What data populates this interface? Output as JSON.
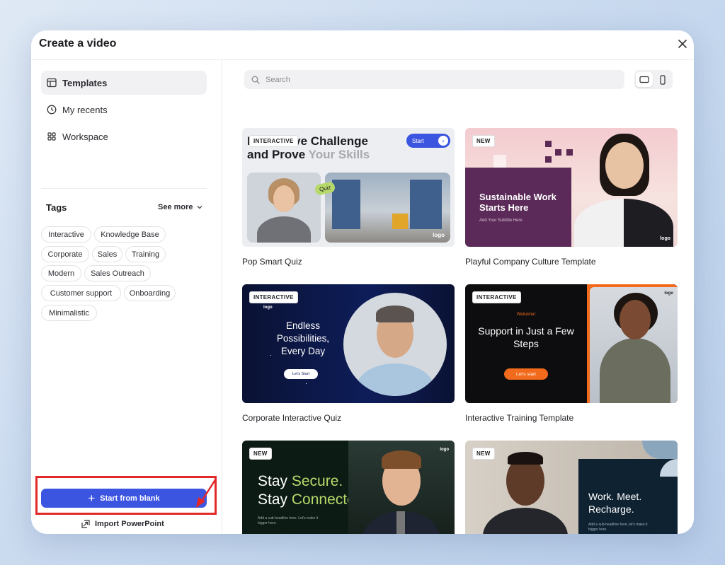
{
  "modal": {
    "title": "Create a video"
  },
  "sidebar": {
    "nav": [
      {
        "label": "Templates",
        "icon": "templates-icon",
        "active": true
      },
      {
        "label": "My recents",
        "icon": "clock-icon"
      },
      {
        "label": "Workspace",
        "icon": "grid-icon"
      }
    ],
    "tags_title": "Tags",
    "see_more": "See more",
    "tags": [
      "Interactive",
      "Knowledge Base",
      "Corporate",
      "Sales",
      "Training",
      "Modern",
      "Sales Outreach",
      "Customer support",
      "Onboarding",
      "Minimalistic"
    ],
    "start_blank": "Start from blank",
    "import_ppt": "Import PowerPoint"
  },
  "search": {
    "placeholder": "Search"
  },
  "templates": [
    {
      "title": "Pop Smart Quiz",
      "badge": "INTERACTIVE",
      "line1": "Interactive Challenge",
      "line2a": "and Prove ",
      "line2b": "Your Skills",
      "btn": "Start",
      "tag": "Quiz",
      "logo": "logo"
    },
    {
      "title": "Playful Company Culture Template",
      "badge": "NEW",
      "headline": "Sustainable Work Starts Here",
      "subtitle": "Add Your Subtitle Here",
      "logo": "logo"
    },
    {
      "title": "Corporate Interactive Quiz",
      "badge": "INTERACTIVE",
      "headline": "Endless Possibilities, Every Day",
      "btn": "Let's Start",
      "logo": "logo"
    },
    {
      "title": "Interactive Training Template",
      "badge": "INTERACTIVE",
      "welcome": "Welcome!",
      "headline": "Support in Just a Few Steps",
      "btn": "Let's start",
      "logo": "logo"
    },
    {
      "title": "",
      "badge": "NEW",
      "l1a": "Stay ",
      "l1b": "Secure.",
      "l2a": "Stay ",
      "l2b": "Connected.",
      "small": "Add a sub-headline here. Let's make it bigger here.",
      "logo": "logo"
    },
    {
      "title": "",
      "badge": "NEW",
      "headline": "Work. Meet. Recharge.",
      "small": "Add a sub-headline here, let's make it bigger here."
    }
  ],
  "colors": {
    "accent": "#3c55e1",
    "highlight": "#e32828",
    "brand_green": "#b7d96b",
    "brand_orange": "#f26a1b"
  }
}
